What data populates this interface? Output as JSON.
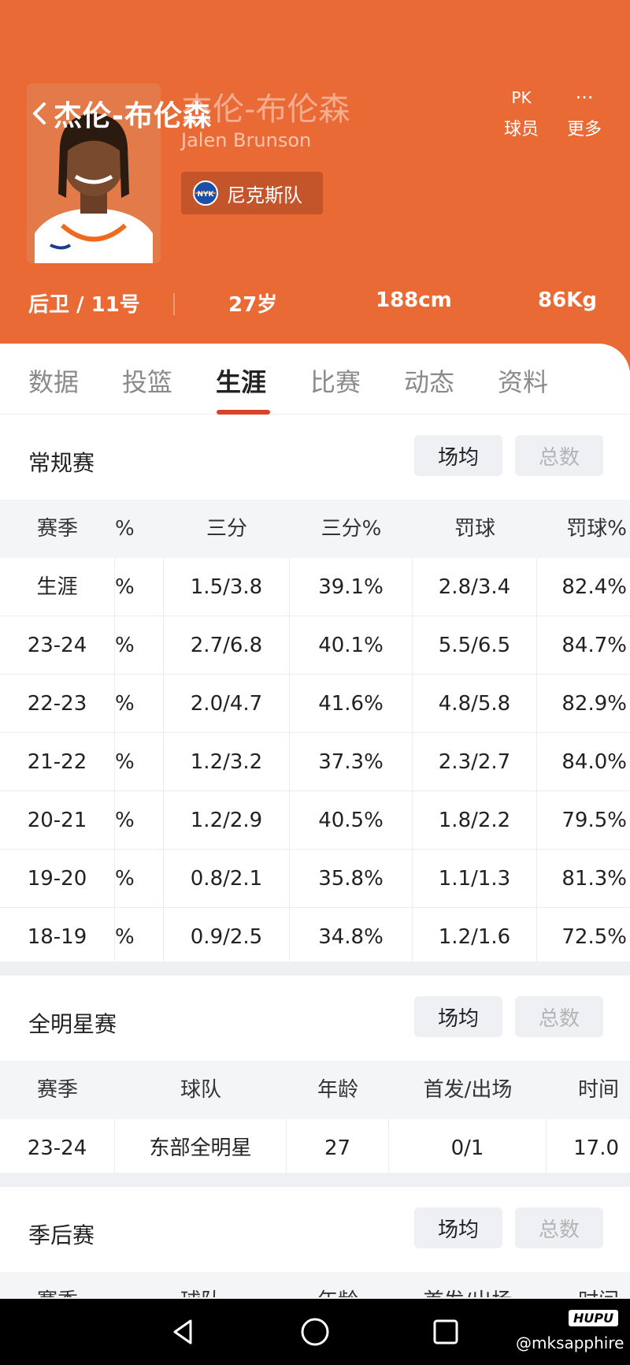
{
  "header": {
    "back_title": "杰伦-布伦森",
    "ghost_name": "杰伦-布伦森",
    "english_name": "Jalen Brunson",
    "team": {
      "logo_text": "NYK",
      "name": "尼克斯队"
    },
    "actions": [
      {
        "icon": "pk-icon",
        "glyph": "PK",
        "label": "球员"
      },
      {
        "icon": "more-icon",
        "glyph": "···",
        "label": "更多"
      }
    ],
    "info": {
      "position": "后卫 / 11号",
      "age": "27岁",
      "height": "188cm",
      "weight": "86Kg"
    }
  },
  "tabs": [
    "数据",
    "投篮",
    "生涯",
    "比赛",
    "动态",
    "资料"
  ],
  "active_tab": "生涯",
  "regular": {
    "title": "常规赛",
    "seg_avg": "场均",
    "seg_total": "总数",
    "headers": [
      "赛季",
      "%",
      "三分",
      "三分%",
      "罚球",
      "罚球%"
    ],
    "rows": [
      [
        "生涯",
        "%",
        "1.5/3.8",
        "39.1%",
        "2.8/3.4",
        "82.4%"
      ],
      [
        "23-24",
        "%",
        "2.7/6.8",
        "40.1%",
        "5.5/6.5",
        "84.7%"
      ],
      [
        "22-23",
        "%",
        "2.0/4.7",
        "41.6%",
        "4.8/5.8",
        "82.9%"
      ],
      [
        "21-22",
        "%",
        "1.2/3.2",
        "37.3%",
        "2.3/2.7",
        "84.0%"
      ],
      [
        "20-21",
        "%",
        "1.2/2.9",
        "40.5%",
        "1.8/2.2",
        "79.5%"
      ],
      [
        "19-20",
        "%",
        "0.8/2.1",
        "35.8%",
        "1.1/1.3",
        "81.3%"
      ],
      [
        "18-19",
        "%",
        "0.9/2.5",
        "34.8%",
        "1.2/1.6",
        "72.5%"
      ]
    ]
  },
  "allstar": {
    "title": "全明星赛",
    "seg_avg": "场均",
    "seg_total": "总数",
    "headers": [
      "赛季",
      "球队",
      "年龄",
      "首发/出场",
      "时间"
    ],
    "rows": [
      [
        "23-24",
        "东部全明星",
        "27",
        "0/1",
        "17.0"
      ]
    ]
  },
  "playoffs": {
    "title": "季后赛",
    "seg_avg": "场均",
    "seg_total": "总数",
    "headers": [
      "赛季",
      "球队",
      "年龄",
      "首发/出场",
      "时间"
    ]
  },
  "overlay": {
    "hupu": "HUPU",
    "watermark": "@mksapphire"
  }
}
